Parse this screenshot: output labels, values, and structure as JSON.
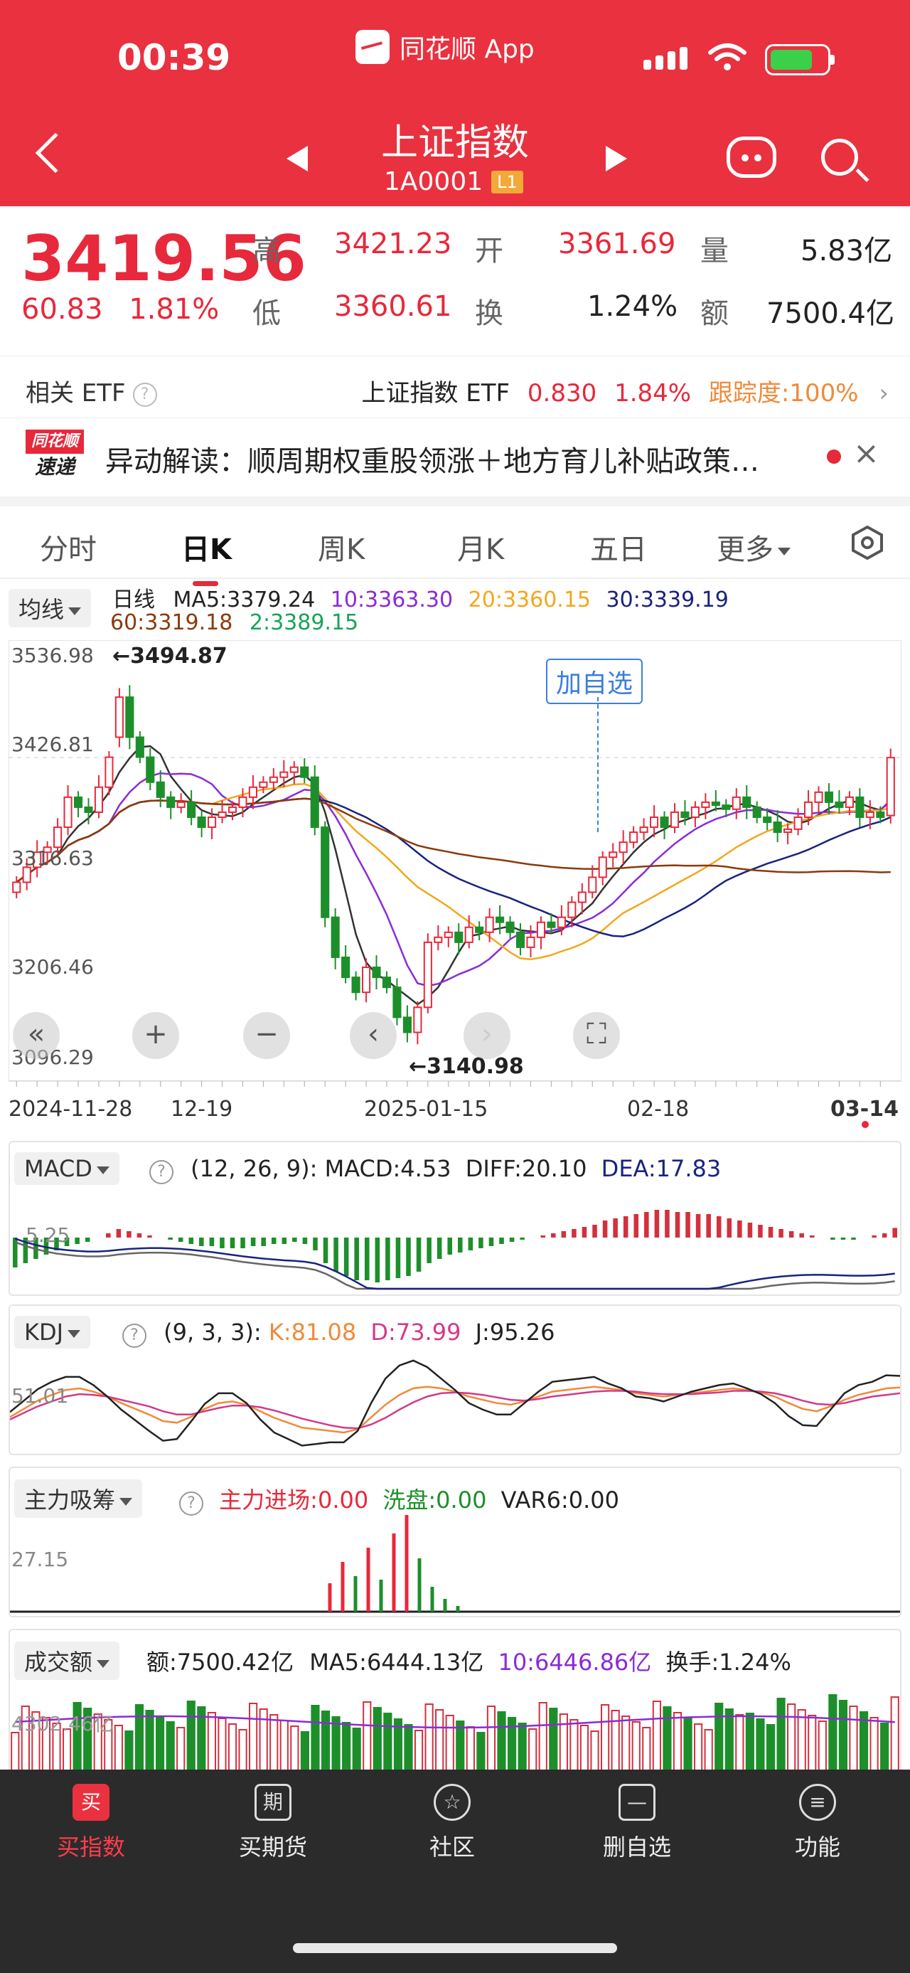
{
  "status": {
    "time": "00:39",
    "app_name": "同花顺 App"
  },
  "header": {
    "title": "上证指数",
    "code": "1A0001",
    "level_badge": "L1"
  },
  "quote": {
    "price": "3419.56",
    "change": "60.83",
    "change_pct": "1.81%",
    "high_label": "高",
    "high": "3421.23",
    "low_label": "低",
    "low": "3360.61",
    "open_label": "开",
    "open": "3361.69",
    "turnover_label": "换",
    "turnover": "1.24%",
    "volume_label": "量",
    "volume": "5.83亿",
    "amount_label": "额",
    "amount": "7500.4亿"
  },
  "etf": {
    "label": "相关 ETF",
    "help": "?",
    "name": "上证指数 ETF",
    "price": "0.830",
    "pct": "1.84%",
    "tracking": "跟踪度:100%"
  },
  "news": {
    "logo_top": "同花顺",
    "logo_bottom": "速递",
    "text": "异动解读：顺周期权重股领涨＋地方育儿补贴政策…",
    "close": "×"
  },
  "tabs": [
    "分时",
    "日K",
    "周K",
    "月K",
    "五日",
    "更多"
  ],
  "main_chart": {
    "indicator_select": "均线",
    "period": "日线",
    "ma": [
      {
        "label": "MA5:3379.24",
        "color": "#333333"
      },
      {
        "label": "10:3363.30",
        "color": "#8b2bd6"
      },
      {
        "label": "20:3360.15",
        "color": "#f2a81d"
      },
      {
        "label": "30:3339.19",
        "color": "#1a237e"
      },
      {
        "label": "60:3319.18",
        "color": "#8b3a0e"
      },
      {
        "label": "2:3389.15",
        "color": "#18a35a"
      }
    ],
    "y_ticks": [
      "3536.98",
      "3426.81",
      "3316.63",
      "3206.46",
      "3096.29"
    ],
    "x_ticks": [
      "2024-11-28",
      "12-19",
      "2025-01-15",
      "02-18",
      "03-14"
    ],
    "high_mark": "←3494.87",
    "low_mark": "←3140.98",
    "add_watch": "加自选"
  },
  "chart_data": [
    {
      "type": "candlestick",
      "title": "日线",
      "x": [
        "2024-11-28",
        "12-19",
        "2025-01-15",
        "02-18",
        "03-14"
      ],
      "ylim": [
        3096.29,
        3536.98
      ],
      "close": [
        3295,
        3310,
        3325,
        3330,
        3350,
        3380,
        3370,
        3365,
        3390,
        3420,
        3480,
        3440,
        3420,
        3395,
        3380,
        3370,
        3375,
        3360,
        3350,
        3360,
        3365,
        3370,
        3380,
        3390,
        3395,
        3400,
        3405,
        3410,
        3400,
        3350,
        3260,
        3220,
        3200,
        3185,
        3210,
        3200,
        3190,
        3160,
        3145,
        3170,
        3235,
        3240,
        3245,
        3235,
        3250,
        3245,
        3260,
        3255,
        3245,
        3230,
        3240,
        3255,
        3250,
        3260,
        3275,
        3285,
        3300,
        3320,
        3325,
        3335,
        3345,
        3350,
        3360,
        3350,
        3365,
        3360,
        3370,
        3375,
        3372,
        3368,
        3380,
        3370,
        3360,
        3355,
        3345,
        3348,
        3360,
        3375,
        3385,
        3375,
        3370,
        3380,
        3360,
        3365,
        3360,
        3419.56
      ],
      "open": [
        3285,
        3295,
        3310,
        3325,
        3330,
        3350,
        3380,
        3370,
        3365,
        3390,
        3440,
        3480,
        3440,
        3420,
        3395,
        3380,
        3370,
        3375,
        3360,
        3350,
        3360,
        3365,
        3370,
        3380,
        3390,
        3395,
        3400,
        3405,
        3410,
        3400,
        3350,
        3260,
        3220,
        3200,
        3185,
        3210,
        3200,
        3190,
        3160,
        3145,
        3170,
        3235,
        3240,
        3245,
        3235,
        3250,
        3245,
        3260,
        3255,
        3245,
        3230,
        3240,
        3255,
        3250,
        3260,
        3275,
        3285,
        3300,
        3320,
        3325,
        3335,
        3345,
        3350,
        3360,
        3350,
        3365,
        3360,
        3370,
        3375,
        3372,
        3368,
        3380,
        3370,
        3360,
        3355,
        3345,
        3348,
        3360,
        3375,
        3385,
        3375,
        3370,
        3380,
        3360,
        3365,
        3361.69
      ],
      "high": 3494.87,
      "low": 3140.98,
      "ma_last": {
        "MA5": 3379.24,
        "MA10": 3363.3,
        "MA20": 3360.15,
        "MA30": 3339.19,
        "MA60": 3319.18,
        "MA2": 3389.15
      }
    },
    {
      "type": "bar",
      "title": "MACD",
      "params": "(12, 26, 9):",
      "labels": {
        "macd": "MACD:4.53",
        "diff": "DIFF:20.10",
        "dea": "DEA:17.83"
      },
      "y_tick": "5.25",
      "values": [
        -14,
        -12,
        -10,
        -8,
        -6,
        -4,
        -3,
        -2,
        0,
        2,
        4,
        3,
        2,
        1,
        0,
        -1,
        -2,
        -3,
        -4,
        -4,
        -5,
        -5,
        -5,
        -4,
        -4,
        -3,
        -3,
        -2,
        -3,
        -6,
        -12,
        -16,
        -18,
        -20,
        -20,
        -21,
        -20,
        -19,
        -18,
        -16,
        -12,
        -10,
        -8,
        -7,
        -6,
        -5,
        -4,
        -3,
        -2,
        -1,
        0,
        1,
        2,
        3,
        4,
        5,
        6,
        8,
        9,
        10,
        11,
        12,
        13,
        13,
        12,
        12,
        11,
        11,
        10,
        9,
        8,
        7,
        6,
        5,
        4,
        3,
        2,
        1,
        0,
        -1,
        -1,
        -1,
        0,
        1,
        2,
        4.53
      ],
      "diff": 20.1,
      "dea": 17.83
    },
    {
      "type": "line",
      "title": "KDJ",
      "params": "(9, 3, 3):",
      "labels": {
        "k": "K:81.08",
        "d": "D:73.99",
        "j": "J:95.26"
      },
      "y_tick": "51.01",
      "series": [
        {
          "name": "K",
          "values": [
            45,
            55,
            65,
            72,
            78,
            80,
            76,
            70,
            62,
            55,
            48,
            40,
            38,
            45,
            55,
            62,
            64,
            60,
            52,
            44,
            38,
            32,
            30,
            28,
            26,
            30,
            45,
            60,
            72,
            80,
            82,
            80,
            76,
            70,
            66,
            62,
            60,
            64,
            70,
            76,
            78,
            80,
            82,
            80,
            78,
            74,
            72,
            70,
            72,
            74,
            76,
            78,
            80,
            78,
            75,
            70,
            62,
            55,
            52,
            58,
            66,
            72,
            76,
            80,
            81.08
          ]
        },
        {
          "name": "D",
          "values": [
            42,
            50,
            58,
            64,
            70,
            73,
            72,
            70,
            66,
            62,
            58,
            52,
            48,
            48,
            52,
            56,
            59,
            59,
            57,
            53,
            48,
            43,
            39,
            35,
            32,
            31,
            36,
            44,
            54,
            63,
            70,
            74,
            75,
            74,
            72,
            69,
            66,
            65,
            67,
            70,
            72,
            74,
            76,
            77,
            77,
            76,
            74,
            73,
            73,
            73,
            74,
            75,
            77,
            77,
            76,
            74,
            70,
            65,
            61,
            60,
            62,
            66,
            70,
            72,
            73.99
          ]
        },
        {
          "name": "J",
          "values": [
            51,
            65,
            79,
            88,
            94,
            94,
            84,
            70,
            54,
            41,
            28,
            16,
            18,
            39,
            61,
            74,
            74,
            62,
            42,
            26,
            18,
            10,
            12,
            14,
            14,
            28,
            63,
            92,
            108,
            114,
            106,
            92,
            78,
            62,
            54,
            48,
            48,
            62,
            76,
            88,
            90,
            92,
            94,
            86,
            80,
            70,
            68,
            64,
            70,
            76,
            80,
            84,
            86,
            80,
            73,
            62,
            46,
            35,
            34,
            54,
            74,
            84,
            88,
            96,
            95.26
          ]
        }
      ]
    },
    {
      "type": "bar",
      "title": "主力吸筹",
      "labels": {
        "inflow": "主力进场:0.00",
        "wash": "洗盘:0.00",
        "var6": "VAR6:0.00"
      },
      "y_tick": "27.15"
    },
    {
      "type": "bar",
      "title": "成交额",
      "labels": {
        "amount": "额:7500.42亿",
        "ma5": "MA5:6444.13亿",
        "ma10": "10:6446.86亿",
        "turnover": "换手:1.24%"
      },
      "y_tick": "4302.46亿"
    }
  ],
  "bottom_nav": [
    {
      "label": "买指数",
      "icon": "买",
      "active": true
    },
    {
      "label": "买期货",
      "icon": "期",
      "active": false
    },
    {
      "label": "社区",
      "icon": "☆",
      "active": false
    },
    {
      "label": "删自选",
      "icon": "—",
      "active": false
    },
    {
      "label": "功能",
      "icon": "≡",
      "active": false
    }
  ]
}
